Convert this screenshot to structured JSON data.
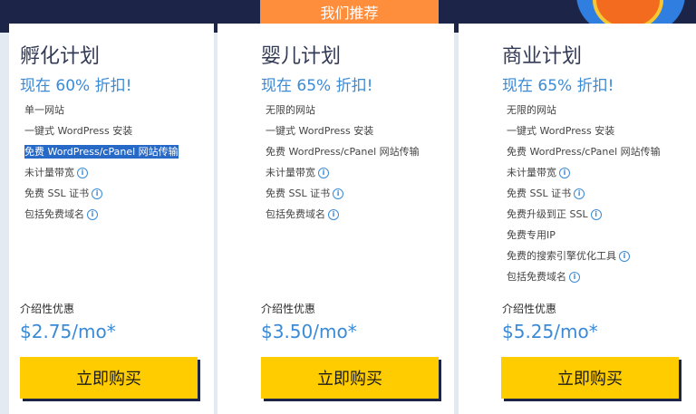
{
  "recommended_badge": "我们推荐",
  "plans": [
    {
      "title": "孵化计划",
      "discount": "现在 60% 折扣!",
      "features": [
        {
          "text": "单一网站",
          "info": false,
          "selected": false
        },
        {
          "text": "一键式 WordPress 安装",
          "info": false,
          "selected": false
        },
        {
          "text": "免费 WordPress/cPanel 网站传输",
          "info": false,
          "selected": true
        },
        {
          "text": "未计量带宽",
          "info": true,
          "selected": false
        },
        {
          "text": "免费 SSL 证书",
          "info": true,
          "selected": false
        },
        {
          "text": "包括免费域名",
          "info": true,
          "selected": false
        }
      ],
      "intro_label": "介绍性优惠",
      "price": "$2.75/mo*",
      "buy_label": "立即购买"
    },
    {
      "title": "婴儿计划",
      "discount": "现在 65% 折扣!",
      "features": [
        {
          "text": "无限的网站",
          "info": false,
          "selected": false
        },
        {
          "text": "一键式 WordPress 安装",
          "info": false,
          "selected": false
        },
        {
          "text": "免费 WordPress/cPanel 网站传输",
          "info": false,
          "selected": false
        },
        {
          "text": "未计量带宽",
          "info": true,
          "selected": false
        },
        {
          "text": "免费 SSL 证书",
          "info": true,
          "selected": false
        },
        {
          "text": "包括免费域名",
          "info": true,
          "selected": false
        }
      ],
      "intro_label": "介绍性优惠",
      "price": "$3.50/mo*",
      "buy_label": "立即购买"
    },
    {
      "title": "商业计划",
      "discount": "现在 65% 折扣!",
      "features": [
        {
          "text": "无限的网站",
          "info": false,
          "selected": false
        },
        {
          "text": "一键式 WordPress 安装",
          "info": false,
          "selected": false
        },
        {
          "text": "免费 WordPress/cPanel 网站传输",
          "info": false,
          "selected": false
        },
        {
          "text": "未计量带宽",
          "info": true,
          "selected": false
        },
        {
          "text": "免费 SSL 证书",
          "info": true,
          "selected": false
        },
        {
          "text": "免费升级到正 SSL",
          "info": true,
          "selected": false
        },
        {
          "text": "免费专用IP",
          "info": false,
          "selected": false
        },
        {
          "text": "免费的搜索引擎优化工具",
          "info": true,
          "selected": false
        },
        {
          "text": "包括免费域名",
          "info": true,
          "selected": false
        }
      ],
      "intro_label": "介绍性优惠",
      "price": "$5.25/mo*",
      "buy_label": "立即购买"
    }
  ],
  "colors": {
    "accent_blue": "#3b8ad6",
    "buy_button": "#ffcc00",
    "badge": "#ff8e3c",
    "navy": "#1c2547"
  },
  "icons": {
    "info": "info-icon"
  }
}
